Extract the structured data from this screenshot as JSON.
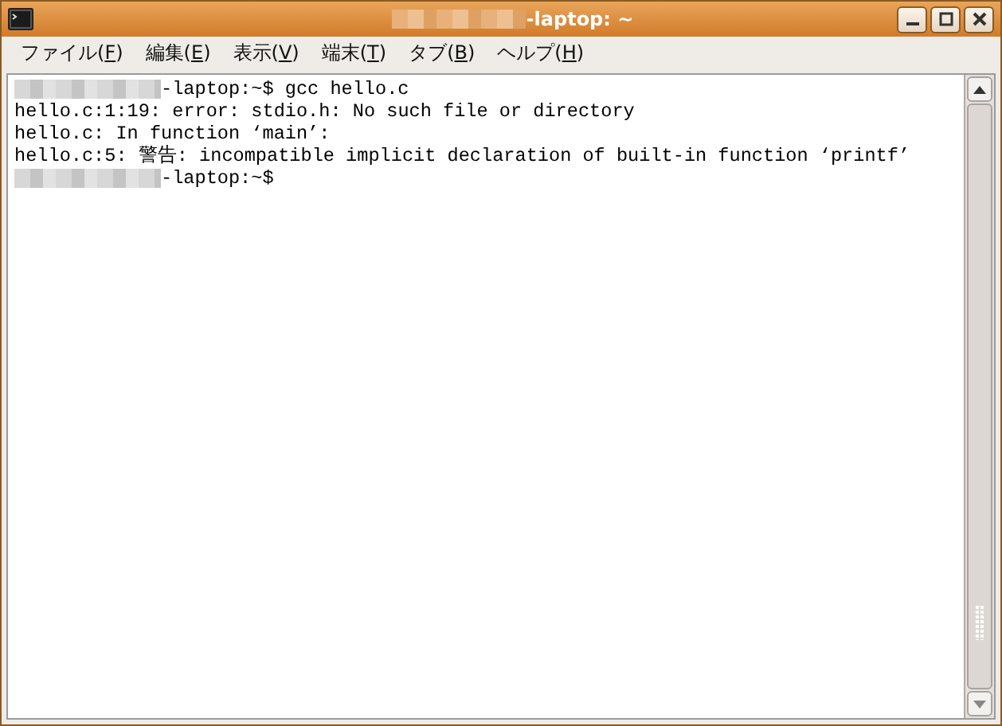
{
  "window": {
    "title": "-laptop: ~"
  },
  "menu": [
    {
      "label": "ファイル(",
      "key": "F",
      "after": ")"
    },
    {
      "label": "編集(",
      "key": "E",
      "after": ")"
    },
    {
      "label": "表示(",
      "key": "V",
      "after": ")"
    },
    {
      "label": "端末(",
      "key": "T",
      "after": ")"
    },
    {
      "label": "タブ(",
      "key": "B",
      "after": ")"
    },
    {
      "label": "ヘルプ(",
      "key": "H",
      "after": ")"
    }
  ],
  "terminal": {
    "lines": [
      {
        "kind": "prompt",
        "text": "-laptop:~$ gcc hello.c"
      },
      {
        "kind": "output",
        "text": "hello.c:1:19: error: stdio.h: No such file or directory"
      },
      {
        "kind": "output",
        "text": "hello.c: In function ‘main’:"
      },
      {
        "kind": "output",
        "text": "hello.c:5: 警告: incompatible implicit declaration of built-in function ‘printf’"
      },
      {
        "kind": "prompt",
        "text": "-laptop:~$"
      }
    ]
  }
}
